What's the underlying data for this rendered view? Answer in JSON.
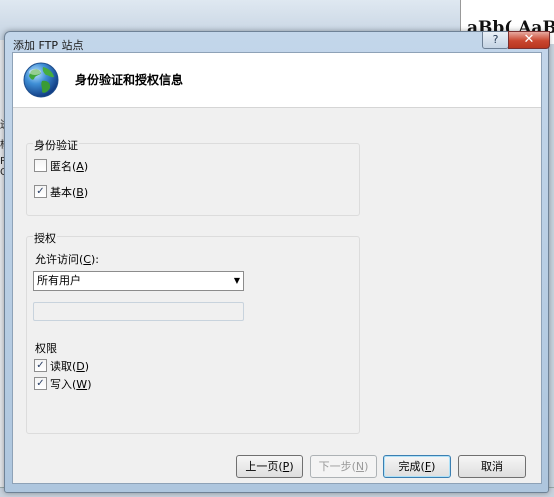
{
  "background": {
    "doc_styles": "aBb(  AaBb(",
    "left_chars": [
      "迸",
      "杨",
      "P O"
    ]
  },
  "dialog": {
    "title": "添加 FTP 站点",
    "help_label": "?",
    "close_label": "✕",
    "header_title": "身份验证和授权信息"
  },
  "authentication": {
    "label": "身份验证",
    "anonymous": {
      "label": "匿名(",
      "key": "A",
      "suffix": ")",
      "checked": false
    },
    "basic": {
      "label": "基本(",
      "key": "B",
      "suffix": ")",
      "checked": true
    }
  },
  "authorization": {
    "label": "授权",
    "allow_access_label": "允许访问(",
    "allow_access_key": "C",
    "allow_access_suffix": "):",
    "allow_access_value": "所有用户",
    "user_text_value": ""
  },
  "permissions": {
    "label": "权限",
    "read": {
      "label": "读取(",
      "key": "D",
      "suffix": ")",
      "checked": true
    },
    "write": {
      "label": "写入(",
      "key": "W",
      "suffix": ")",
      "checked": true
    }
  },
  "buttons": {
    "previous": {
      "label": "上一页(",
      "key": "P",
      "suffix": ")"
    },
    "next": {
      "label": "下一步(",
      "key": "N",
      "suffix": ")"
    },
    "finish": {
      "label": "完成(",
      "key": "F",
      "suffix": ")"
    },
    "cancel": "取消"
  },
  "check_mark": "✓"
}
